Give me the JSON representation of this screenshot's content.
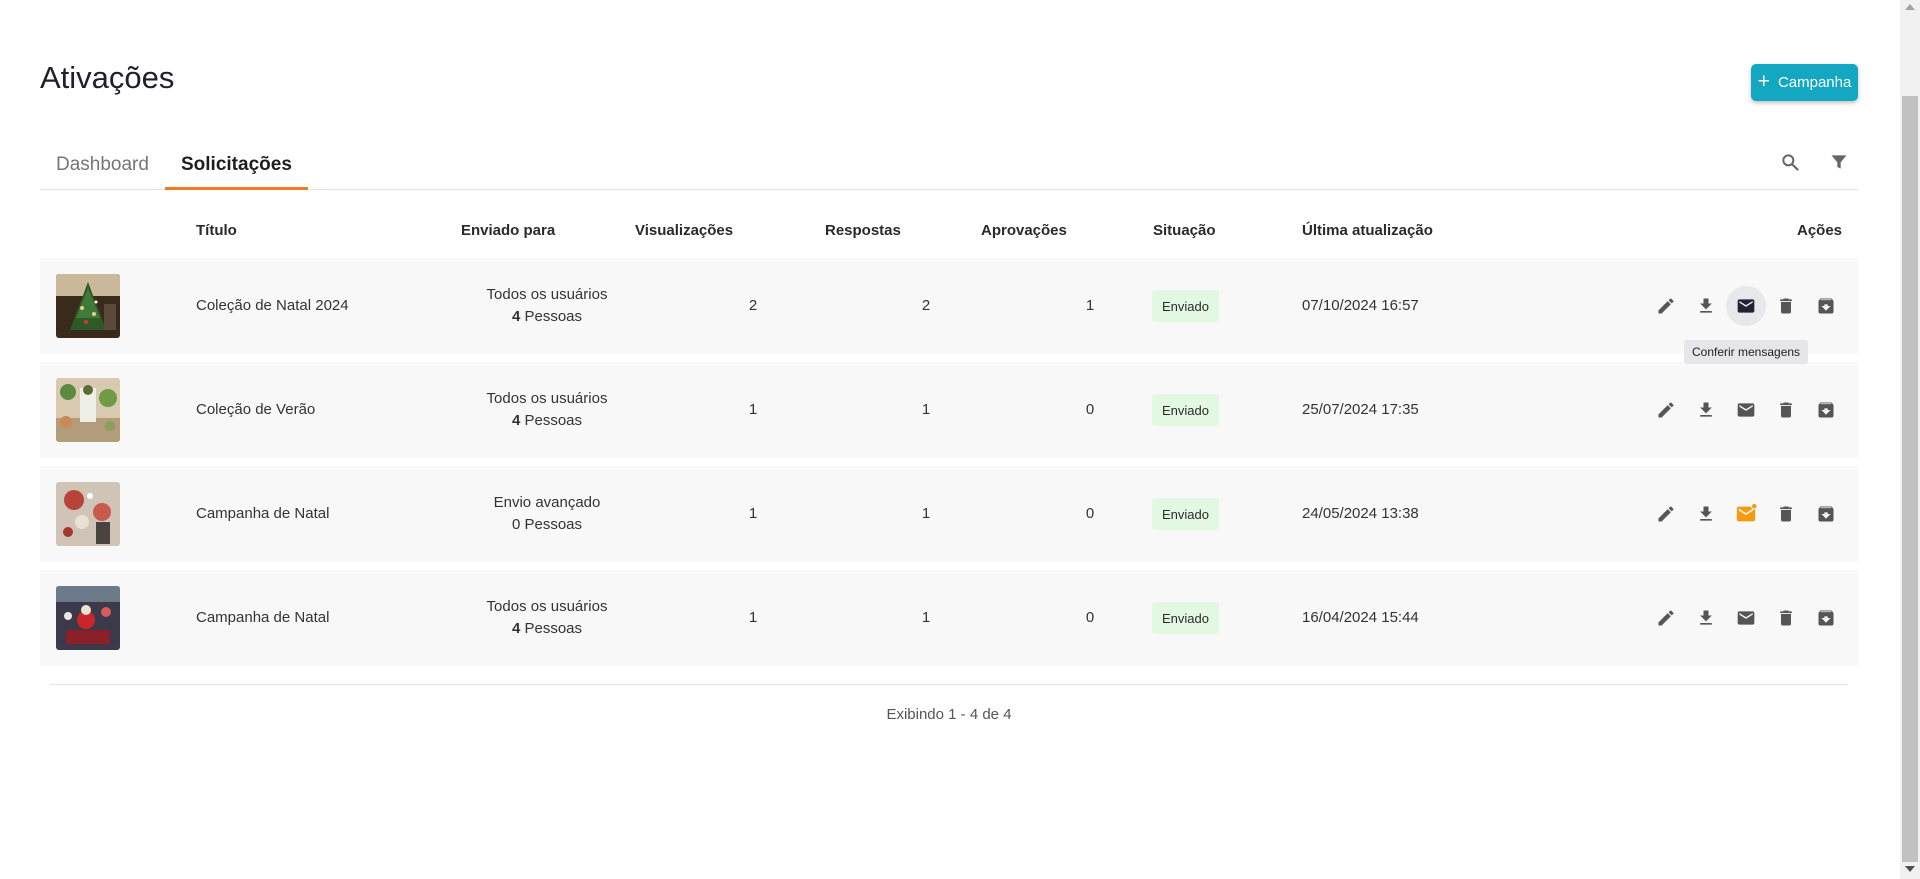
{
  "page": {
    "title": "Ativações",
    "campaign_button_label": "Campanha"
  },
  "tabs": [
    {
      "label": "Dashboard",
      "active": false
    },
    {
      "label": "Solicitações",
      "active": true
    }
  ],
  "toolbar": {
    "search_icon": "search-icon",
    "filter_icon": "filter-icon"
  },
  "table": {
    "columns": [
      "Título",
      "Enviado para",
      "Visualizações",
      "Respostas",
      "Aprovações",
      "Situação",
      "Última atualização",
      "Ações"
    ],
    "rows": [
      {
        "title": "Coleção de Natal 2024",
        "sent_line1": "Todos os usuários",
        "sent_count": "4",
        "sent_unit": "Pessoas",
        "views": "2",
        "responses": "2",
        "approvals": "1",
        "status": "Enviado",
        "updated": "07/10/2024 16:57",
        "message_state": "hover"
      },
      {
        "title": "Coleção de Verão",
        "sent_line1": "Todos os usuários",
        "sent_count": "4",
        "sent_unit": "Pessoas",
        "views": "1",
        "responses": "1",
        "approvals": "0",
        "status": "Enviado",
        "updated": "25/07/2024 17:35",
        "message_state": "normal"
      },
      {
        "title": "Campanha de Natal",
        "sent_line1": "Envio avançado",
        "sent_count": "0",
        "sent_unit": "Pessoas",
        "views": "1",
        "responses": "1",
        "approvals": "0",
        "status": "Enviado",
        "updated": "24/05/2024 13:38",
        "message_state": "new"
      },
      {
        "title": "Campanha de Natal",
        "sent_line1": "Todos os usuários",
        "sent_count": "4",
        "sent_unit": "Pessoas",
        "views": "1",
        "responses": "1",
        "approvals": "0",
        "status": "Enviado",
        "updated": "16/04/2024 15:44",
        "message_state": "normal"
      }
    ]
  },
  "tooltip": "Conferir mensagens",
  "footer": "Exibindo 1 - 4 de 4",
  "colors": {
    "accent": "#13a7c1",
    "tab_indicator": "#ef7d1f",
    "status_badge_bg": "#e3f8e2",
    "new_message": "#f39c12",
    "icon_gray": "#555555"
  }
}
